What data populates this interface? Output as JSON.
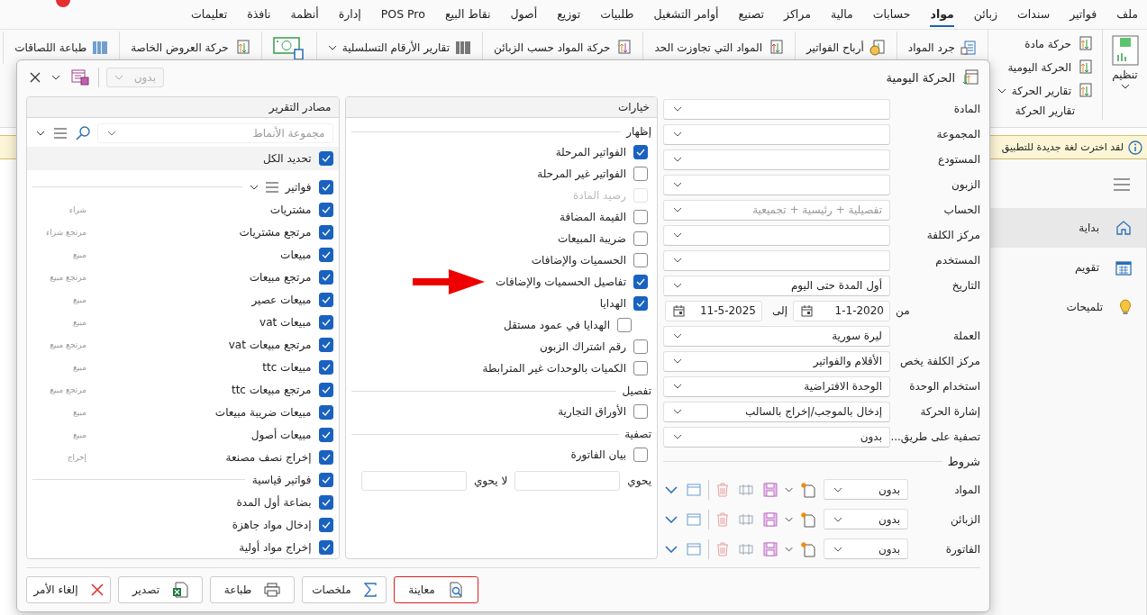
{
  "menu": [
    {
      "label": "ملف",
      "selected": false
    },
    {
      "label": "فواتير",
      "selected": false
    },
    {
      "label": "سندات",
      "selected": false
    },
    {
      "label": "زبائن",
      "selected": false
    },
    {
      "label": "مواد",
      "selected": true
    },
    {
      "label": "حسابات",
      "selected": false
    },
    {
      "label": "مالية",
      "selected": false
    },
    {
      "label": "مراكز",
      "selected": false
    },
    {
      "label": "تصنيع",
      "selected": false
    },
    {
      "label": "أوامر التشغيل",
      "selected": false
    },
    {
      "label": "طلبيات",
      "selected": false
    },
    {
      "label": "توزيع",
      "selected": false
    },
    {
      "label": "أصول",
      "selected": false
    },
    {
      "label": "نقاط البيع",
      "selected": false
    },
    {
      "label": "POS Pro",
      "selected": false
    },
    {
      "label": "إدارة",
      "selected": false
    },
    {
      "label": "أنظمة",
      "selected": false
    },
    {
      "label": "نافذة",
      "selected": false
    },
    {
      "label": "تعليمات",
      "selected": false
    }
  ],
  "ribbon": {
    "arrange": {
      "label": "تنظيم"
    },
    "group": {
      "label": "تقارير الحركة",
      "items": [
        {
          "label": "حركة مادة",
          "dropdown": false
        },
        {
          "label": "الحركة اليومية",
          "dropdown": false
        },
        {
          "label": "تقارير الحركة",
          "dropdown": true
        }
      ]
    },
    "tools": [
      {
        "kind": "button",
        "label": "جرد المواد"
      },
      {
        "kind": "button",
        "label": "أرباح الفواتير"
      },
      {
        "kind": "button",
        "label": "المواد التي تجاوزت الحد"
      },
      {
        "kind": "button",
        "label": "حركة المواد حسب الزبائن"
      },
      {
        "kind": "dropdown",
        "label": "تقارير الأرقام التسلسلية"
      },
      {
        "kind": "icon"
      },
      {
        "kind": "button",
        "label": "حركة العروض الخاصة"
      },
      {
        "kind": "button",
        "label": "طباعة اللصاقات"
      }
    ]
  },
  "info_bar": {
    "text": "لقد اخترت لغة جديدة للتطبيق"
  },
  "sidebar": {
    "items": [
      {
        "label": "بداية",
        "selected": true
      },
      {
        "label": "تقويم",
        "selected": false
      },
      {
        "label": "تلميحات",
        "selected": false
      }
    ]
  },
  "dialog": {
    "title": "الحركة اليومية",
    "layout_combo": {
      "value": "بدون",
      "disabled": true
    },
    "fields": [
      {
        "kind": "combo",
        "label": "المادة"
      },
      {
        "kind": "combo",
        "label": "المجموعة"
      },
      {
        "kind": "combo",
        "label": "المستودع"
      },
      {
        "kind": "combo",
        "label": "الزبون"
      },
      {
        "kind": "combo",
        "label": "الحساب",
        "placeholder": "تفصيلية + رئيسية + تجميعية"
      },
      {
        "kind": "combo",
        "label": "مركز الكلفة"
      },
      {
        "kind": "combo",
        "label": "المستخدم"
      },
      {
        "kind": "combo",
        "label": "التاريخ",
        "value": "أول المدة حتى اليوم"
      },
      {
        "kind": "dates",
        "from_label": "من",
        "from": "1-1-2020",
        "to_label": "إلى",
        "to": "11-5-2025"
      },
      {
        "kind": "combo",
        "label": "العملة",
        "value": "ليرة سورية"
      },
      {
        "kind": "combo",
        "label": "مركز الكلفة يخص",
        "value": "الأقلام والفواتير"
      },
      {
        "kind": "combo",
        "label": "استخدام الوحدة",
        "value": "الوحدة الافتراضية"
      },
      {
        "kind": "combo",
        "label": "إشارة الحركة",
        "value": "إدخال بالموجب/إخراج بالسالب"
      },
      {
        "kind": "combo",
        "label": "تصفية على طريق...",
        "value": "بدون"
      }
    ],
    "conditions_title": "شروط",
    "conditions": [
      {
        "label": "المواد",
        "value": "بدون"
      },
      {
        "label": "الزبائن",
        "value": "بدون"
      },
      {
        "label": "الفاتورة",
        "value": "بدون"
      }
    ],
    "options": {
      "title": "خيارات",
      "sections": [
        {
          "title": "إظهار",
          "items": [
            {
              "label": "الفواتير المرحلة",
              "checked": true,
              "disabled": false
            },
            {
              "label": "الفواتير غير المرحلة",
              "checked": false,
              "disabled": false
            },
            {
              "label": "رصيد المادة",
              "checked": false,
              "disabled": true
            },
            {
              "label": "القيمة المضافة",
              "checked": false,
              "disabled": false
            },
            {
              "label": "ضريبة المبيعات",
              "checked": false,
              "disabled": false
            },
            {
              "label": "الحسميات والإضافات",
              "checked": false,
              "disabled": false
            },
            {
              "label": "تفاصيل الحسميات والإضافات",
              "checked": true,
              "disabled": false,
              "marked": true
            },
            {
              "label": "الهدايا",
              "checked": true,
              "disabled": false,
              "children": [
                {
                  "label": "الهدايا في عمود مستقل",
                  "checked": false,
                  "disabled": false
                }
              ]
            },
            {
              "label": "رقم اشتراك الزبون",
              "checked": false,
              "disabled": false
            },
            {
              "label": "الكميات بالوحدات غير المترابطة",
              "checked": false,
              "disabled": false
            }
          ]
        },
        {
          "title": "تفصيل",
          "items": [
            {
              "label": "الأوراق التجارية",
              "checked": false,
              "disabled": false
            }
          ]
        },
        {
          "title": "تصفية",
          "items": [
            {
              "label": "بيان الفاتورة",
              "checked": false,
              "disabled": false
            }
          ]
        }
      ],
      "contains_label": "يحوي",
      "not_contains_label": "لا يحوي"
    },
    "sources": {
      "title": "مصادر التقرير",
      "pattern_placeholder": "مجموعة الأنماط",
      "select_all": {
        "label": "تحديد الكل",
        "checked": true
      },
      "groups": [
        {
          "label": "فواتير",
          "checked": true,
          "menu": true,
          "children": [
            {
              "label": "مشتريات",
              "type": "شراء",
              "checked": true
            },
            {
              "label": "مرتجع مشتريات",
              "type": "مرتجع شراء",
              "checked": true
            },
            {
              "label": "مبيعات",
              "type": "مبيع",
              "checked": true
            },
            {
              "label": "مرتجع مبيعات",
              "type": "مرتجع مبيع",
              "checked": true
            },
            {
              "label": "مبيعات عصير",
              "type": "مبيع",
              "checked": true
            },
            {
              "label": "مبيعات vat",
              "type": "مبيع",
              "checked": true
            },
            {
              "label": "مرتجع مبيعات vat",
              "type": "مرتجع مبيع",
              "checked": true
            },
            {
              "label": "مبيعات ttc",
              "type": "مبيع",
              "checked": true
            },
            {
              "label": "مرتجع مبيعات ttc",
              "type": "مرتجع مبيع",
              "checked": true
            },
            {
              "label": "مبيعات ضريبة مبيعات",
              "type": "مبيع",
              "checked": true
            },
            {
              "label": "مبيعات أصول",
              "type": "مبيع",
              "checked": true
            },
            {
              "label": "إخراج نصف مصنعة",
              "type": "إخراج",
              "checked": true
            }
          ]
        },
        {
          "label": "فواتير قياسية",
          "checked": true,
          "menu": false,
          "children": [
            {
              "label": "بضاعة أول المدة",
              "checked": true
            },
            {
              "label": "إدخال مواد جاهزة",
              "checked": true
            },
            {
              "label": "إخراج مواد أولية",
              "checked": true
            }
          ]
        }
      ]
    },
    "buttons": [
      {
        "label": "معاينة",
        "focused": true
      },
      {
        "label": "ملخصات",
        "focused": false
      },
      {
        "label": "طباعة",
        "focused": false
      },
      {
        "label": "تصدير",
        "focused": false
      },
      {
        "label": "إلغاء الأمر",
        "focused": false
      }
    ]
  }
}
